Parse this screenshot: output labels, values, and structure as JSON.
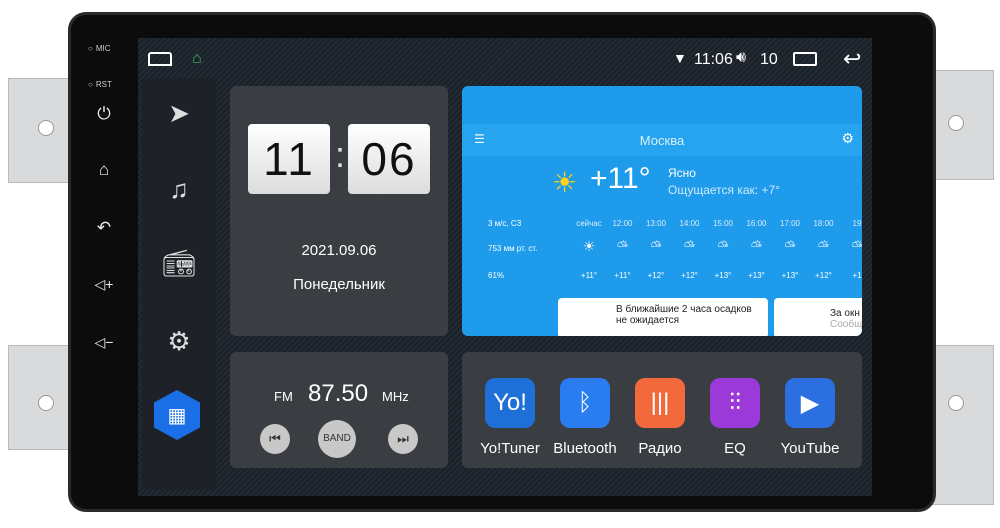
{
  "hardware": {
    "mic_label": "MIC",
    "rst_label": "RST"
  },
  "status_bar": {
    "time": "11:06",
    "volume": "10"
  },
  "clock_widget": {
    "hour": "11",
    "minute": "06",
    "separator": ":",
    "date": "2021.09.06",
    "weekday": "Понедельник"
  },
  "weather": {
    "city": "Москва",
    "temperature": "+11°",
    "condition": "Ясно",
    "feels_like": "Ощущается как: +7°",
    "wind": "3 м/с, СЗ",
    "pressure": "753 мм рт. ст.",
    "humidity": "61%",
    "hours": [
      "сейчас",
      "12:00",
      "13:00",
      "14:00",
      "15:00",
      "16:00",
      "17:00",
      "18:00",
      "19"
    ],
    "temps": [
      "+11°",
      "+11°",
      "+12°",
      "+12°",
      "+13°",
      "+13°",
      "+13°",
      "+12°",
      "+1"
    ],
    "precip_card": "В ближайшие 2 часа осадков не ожидается",
    "window_card_title": "За окн",
    "window_card_sub": "Сообщ"
  },
  "radio": {
    "band_label": "FM",
    "frequency": "87.50",
    "unit": "MHz",
    "band_button": "BAND"
  },
  "apps": [
    {
      "label": "Yo!Tuner",
      "color": "#1f6fd8"
    },
    {
      "label": "Bluetooth",
      "color": "#2a7df0"
    },
    {
      "label": "Радио",
      "color": "#f26a3c"
    },
    {
      "label": "EQ",
      "color": "#9b3ad8"
    },
    {
      "label": "YouTube",
      "color": "#2b6fe0"
    }
  ],
  "accent": "#1b6fe6"
}
